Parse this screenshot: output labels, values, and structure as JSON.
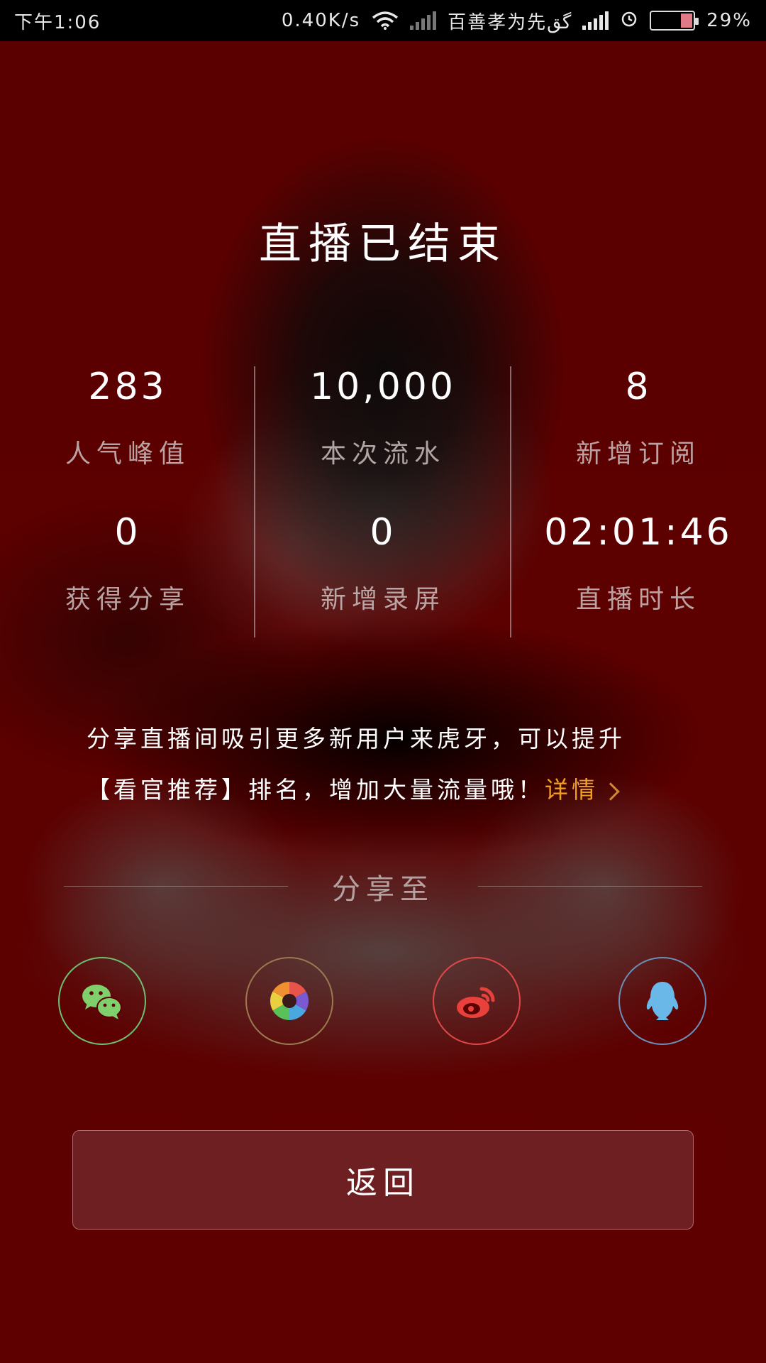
{
  "status_bar": {
    "time": "下午1:06",
    "net_speed": "0.40K/s",
    "carrier": "百善孝为先گق",
    "battery_percent": "29%",
    "icons": [
      "wifi-icon",
      "signal-icon",
      "alarm-icon",
      "battery-icon"
    ]
  },
  "title": "直播已结束",
  "stats": [
    {
      "value": "283",
      "label": "人气峰值"
    },
    {
      "value": "10,000",
      "label": "本次流水"
    },
    {
      "value": "8",
      "label": "新增订阅"
    },
    {
      "value": "0",
      "label": "获得分享"
    },
    {
      "value": "0",
      "label": "新增录屏"
    },
    {
      "value": "02:01:46",
      "label": "直播时长"
    }
  ],
  "promo": {
    "line1": "分享直播间吸引更多新用户来虎牙，可以提升",
    "line2": "【看官推荐】排名，增加大量流量哦！",
    "detail": "详情"
  },
  "share": {
    "title": "分享至",
    "targets": [
      {
        "name": "wechat",
        "icon": "wechat-icon",
        "color": "#6cc070"
      },
      {
        "name": "moments",
        "icon": "moments-icon",
        "color": "#9a7a50"
      },
      {
        "name": "weibo",
        "icon": "weibo-icon",
        "color": "#e04848"
      },
      {
        "name": "qq",
        "icon": "qq-icon",
        "color": "#6a8fb8"
      }
    ]
  },
  "return_button": "返回"
}
